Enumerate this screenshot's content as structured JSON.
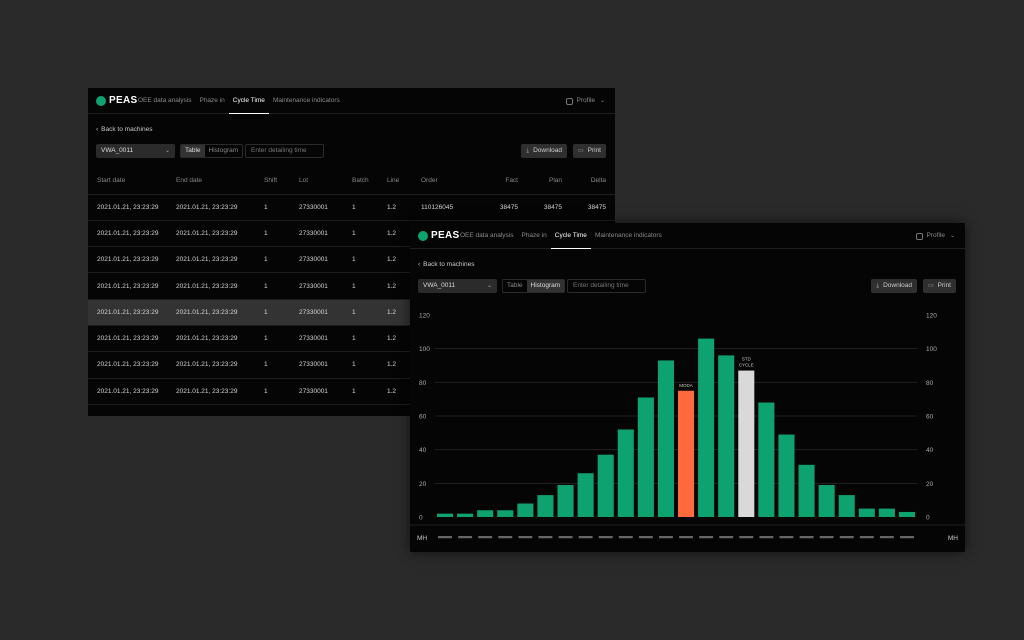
{
  "app": {
    "logo": "PEAS",
    "nav_tabs": [
      "OEE data analysis",
      "Phaze in",
      "Cycle Time",
      "Maintenance indicators"
    ],
    "active_tab": "Cycle Time",
    "profile": "Profile",
    "back_label": "Back to machines",
    "machine_select": "VWA_0011",
    "view_table": "Table",
    "view_histogram": "Histogram",
    "detail_placeholder": "Enter detailing time",
    "download_label": "Download",
    "print_label": "Print",
    "accent": "#0ea271"
  },
  "table": {
    "columns": [
      "Start date",
      "End date",
      "Shift",
      "Lot",
      "Batch",
      "Line",
      "Order",
      "Fact",
      "Plan",
      "Delta"
    ],
    "rows": [
      [
        "2021.01.21, 23:23:29",
        "2021.01.21, 23:23:29",
        "1",
        "27330001",
        "1",
        "1.2",
        "110126045",
        "38475",
        "38475",
        "38475"
      ],
      [
        "2021.01.21, 23:23:29",
        "2021.01.21, 23:23:29",
        "1",
        "27330001",
        "1",
        "1.2",
        "",
        "",
        "",
        ""
      ],
      [
        "2021.01.21, 23:23:29",
        "2021.01.21, 23:23:29",
        "1",
        "27330001",
        "1",
        "1.2",
        "",
        "",
        "",
        ""
      ],
      [
        "2021.01.21, 23:23:29",
        "2021.01.21, 23:23:29",
        "1",
        "27330001",
        "1",
        "1.2",
        "",
        "",
        "",
        ""
      ],
      [
        "2021.01.21, 23:23:29",
        "2021.01.21, 23:23:29",
        "1",
        "27330001",
        "1",
        "1.2",
        "",
        "",
        "",
        ""
      ],
      [
        "2021.01.21, 23:23:29",
        "2021.01.21, 23:23:29",
        "1",
        "27330001",
        "1",
        "1.2",
        "",
        "",
        "",
        ""
      ],
      [
        "2021.01.21, 23:23:29",
        "2021.01.21, 23:23:29",
        "1",
        "27330001",
        "1",
        "1.2",
        "",
        "",
        "",
        ""
      ],
      [
        "2021.01.21, 23:23:29",
        "2021.01.21, 23:23:29",
        "1",
        "27330001",
        "1",
        "1.2",
        "",
        "",
        "",
        ""
      ]
    ],
    "selected_row": 4
  },
  "chart_data": {
    "type": "bar",
    "ylim": [
      0,
      120
    ],
    "yticks": [
      0,
      20,
      40,
      60,
      80,
      100,
      120
    ],
    "axis_end_label": "MH",
    "values": [
      2,
      2,
      4,
      4,
      8,
      13,
      19,
      26,
      37,
      52,
      71,
      93,
      75,
      106,
      96,
      87,
      68,
      49,
      31,
      19,
      13,
      5,
      5,
      3
    ],
    "colors": {
      "default": "#0ea271",
      "moda": "#ff6a3d",
      "std": "#d9d9d9"
    },
    "moda_index": 12,
    "std_index": 15,
    "moda_label": "MODA",
    "std_label": [
      "STD",
      "CYCLE"
    ],
    "grid": true
  }
}
